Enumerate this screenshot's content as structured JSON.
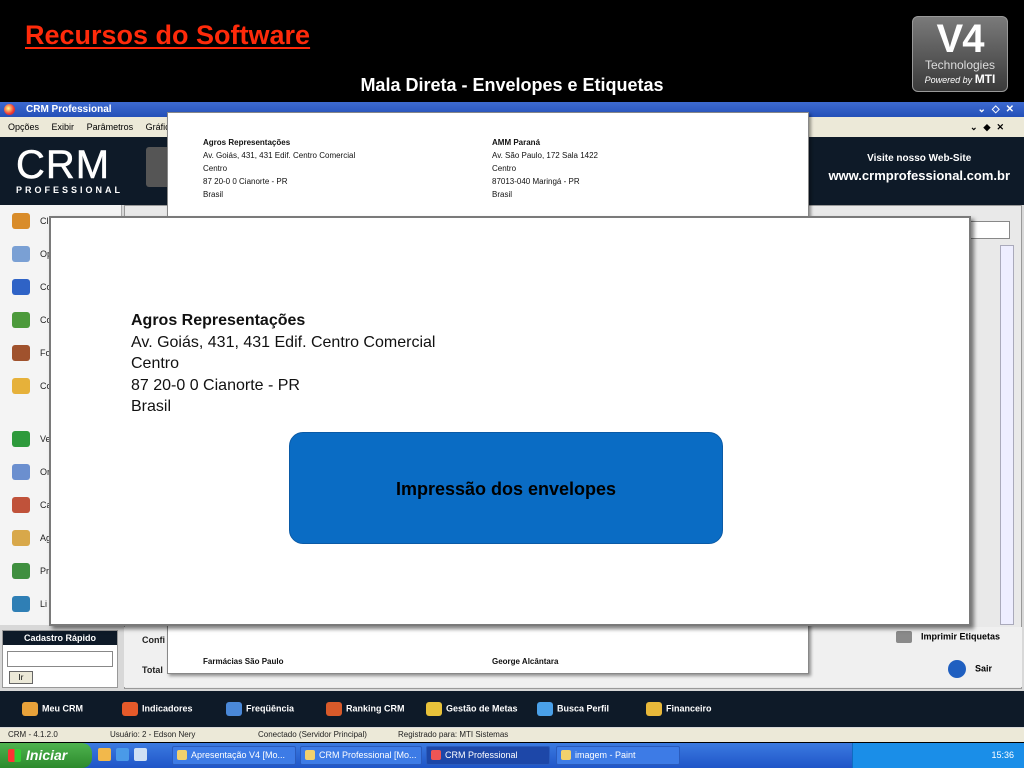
{
  "slide": {
    "title": "Recursos do Software",
    "subtitle": "Mala Direta - Envelopes e Etiquetas",
    "logo": {
      "big": "V4",
      "tech": "Technologies",
      "powered": "Powered by",
      "brand": "MTI"
    }
  },
  "app": {
    "window_title": "CRM Professional",
    "menu": [
      "Opções",
      "Exibir",
      "Parâmetros",
      "Gráfic"
    ],
    "banner": {
      "logo": "CRM",
      "logo_sub": "PROFESSIONAL",
      "site_label": "Visite nosso Web-Site",
      "site_url": "www.crmprofessional.com.br"
    },
    "sidebar": [
      {
        "label": "Cl",
        "icon": "people-icon",
        "color": "#d98c2a"
      },
      {
        "label": "Op",
        "icon": "printer-icon",
        "color": "#7aa0d4"
      },
      {
        "label": "Co",
        "icon": "phone-icon",
        "color": "#2f63c6"
      },
      {
        "label": "Co",
        "icon": "building-icon",
        "color": "#4c9a3b"
      },
      {
        "label": "Fo",
        "icon": "box-icon",
        "color": "#a0522d"
      },
      {
        "label": "Co",
        "icon": "folder-icon",
        "color": "#e6b13a"
      },
      {
        "label": "Ve",
        "icon": "dollar-icon",
        "color": "#2e9a3c"
      },
      {
        "label": "Or",
        "icon": "document-icon",
        "color": "#6b8fcf"
      },
      {
        "label": "Ca",
        "icon": "network-icon",
        "color": "#c0523a"
      },
      {
        "label": "Ag",
        "icon": "clipboard-icon",
        "color": "#d8a84a"
      },
      {
        "label": "Pr",
        "icon": "pencil-icon",
        "color": "#3f8f3f"
      },
      {
        "label": "Li",
        "icon": "recycle-icon",
        "color": "#2f7fb5"
      }
    ],
    "quick": {
      "title": "Cadastro Rápido",
      "button": "Ir"
    },
    "bottom": {
      "config": "Confi",
      "total": "Total",
      "print": "Imprimir Etiquetas",
      "exit": "Sair"
    },
    "nav": [
      {
        "label": "Meu CRM",
        "color": "#e8a23a"
      },
      {
        "label": "Indicadores",
        "color": "#e65a2a"
      },
      {
        "label": "Freqüência",
        "color": "#4a88d8"
      },
      {
        "label": "Ranking CRM",
        "color": "#d85a2a"
      },
      {
        "label": "Gestão de Metas",
        "color": "#e8c23a"
      },
      {
        "label": "Busca Perfil",
        "color": "#4aa0e8"
      },
      {
        "label": "Financeiro",
        "color": "#e8b83a"
      }
    ],
    "status": [
      "CRM - 4.1.2.0",
      "Usuário: 2 - Edson Nery",
      "Conectado (Servidor Principal)",
      "Registrado para: MTI Sistemas"
    ]
  },
  "labels_sheet": {
    "top": [
      {
        "name": "Agros Representações",
        "l1": "Av. Goiás, 431, 431   Edif. Centro Comercial",
        "l2": "Centro",
        "l3": "87 20-0 0       Cianorte - PR",
        "l4": "Brasil"
      },
      {
        "name": "AMM Paraná",
        "l1": "Av. São Paulo, 172   Sala 1422",
        "l2": "Centro",
        "l3": "87013-040       Maringá - PR",
        "l4": "Brasil"
      }
    ],
    "bottom": [
      {
        "name": "Farmácias São Paulo"
      },
      {
        "name": "George Alcântara"
      }
    ]
  },
  "envelope": {
    "name": "Agros Representações",
    "l1": "Av. Goiás, 431, 431   Edif. Centro Comercial",
    "l2": "Centro",
    "l3": "87 20-0 0       Cianorte - PR",
    "l4": "Brasil"
  },
  "callout": "Impressão dos envelopes",
  "taskbar": {
    "start": "Iniciar",
    "tasks": [
      "Apresentação V4 [Mo...",
      "CRM Professional [Mo...",
      "CRM Professional",
      "imagem - Paint"
    ],
    "clock": "15:36"
  }
}
